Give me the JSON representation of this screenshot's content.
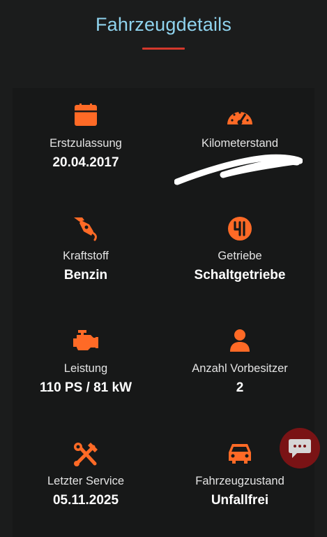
{
  "header": {
    "title": "Fahrzeugdetails"
  },
  "colors": {
    "accent": "#ff6a26",
    "title": "#8fd3ee",
    "underline": "#d4382c",
    "chat_bg": "#7a1315"
  },
  "details": [
    {
      "icon": "calendar-icon",
      "label": "Erstzulassung",
      "value": "20.04.2017"
    },
    {
      "icon": "speedometer-icon",
      "label": "Kilometerstand",
      "value": ""
    },
    {
      "icon": "fuel-nozzle-icon",
      "label": "Kraftstoff",
      "value": "Benzin"
    },
    {
      "icon": "gear-shift-icon",
      "label": "Getriebe",
      "value": "Schaltgetriebe"
    },
    {
      "icon": "engine-icon",
      "label": "Leistung",
      "value": "110 PS / 81 kW"
    },
    {
      "icon": "person-icon",
      "label": "Anzahl Vorbesitzer",
      "value": "2"
    },
    {
      "icon": "tools-icon",
      "label": "Letzter Service",
      "value": "05.11.2025"
    },
    {
      "icon": "car-icon",
      "label": "Fahrzeugzustand",
      "value": "Unfallfrei"
    }
  ],
  "chat": {
    "icon": "chat-bubble-icon"
  }
}
